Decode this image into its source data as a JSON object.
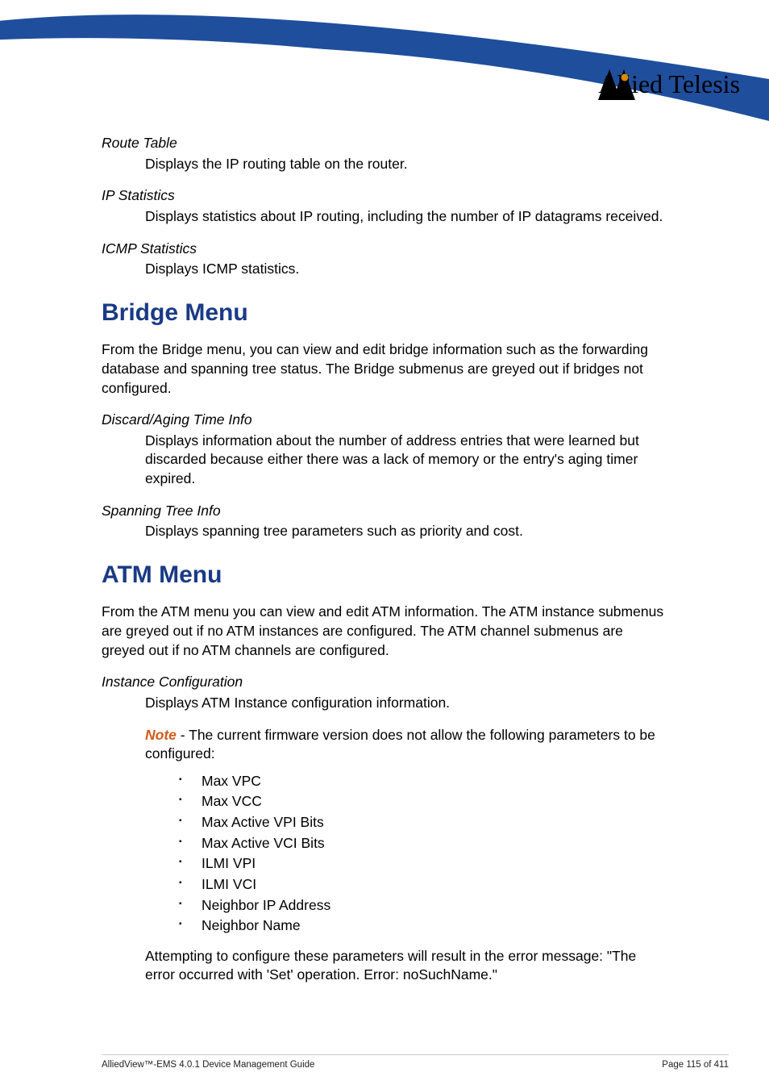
{
  "logo_text": "Allied Telesis",
  "sections": {
    "route_table": {
      "term": "Route Table",
      "desc": "Displays the IP routing table on the router."
    },
    "ip_statistics": {
      "term": "IP Statistics",
      "desc": "Displays statistics about IP routing, including the number of IP datagrams received."
    },
    "icmp_statistics": {
      "term": "ICMP Statistics",
      "desc": "Displays ICMP statistics."
    },
    "bridge_heading": "Bridge Menu",
    "bridge_intro": "From the Bridge menu, you can view and edit bridge information such as the forwarding database and spanning tree status. The Bridge submenus are greyed out if bridges not configured.",
    "discard_aging": {
      "term": "Discard/Aging Time Info",
      "desc": "Displays information about the number of address entries that were learned but discarded because either there was a lack of memory or the entry's aging timer expired."
    },
    "spanning_tree": {
      "term": "Spanning Tree Info",
      "desc": "Displays spanning tree parameters such as priority and cost."
    },
    "atm_heading": "ATM Menu",
    "atm_intro": "From the ATM menu you can view and edit ATM information. The ATM instance submenus are greyed out if no ATM instances are configured. The ATM channel submenus are greyed out if no ATM channels are configured.",
    "instance_config": {
      "term": "Instance Configuration",
      "desc": "Displays ATM Instance configuration information."
    },
    "note_word": "Note",
    "note_rest": " - The current firmware version does not allow the following parameters to be configured:",
    "params": [
      "Max VPC",
      "Max VCC",
      "Max Active VPI Bits",
      "Max Active VCI Bits",
      "ILMI VPI",
      "ILMI VCI",
      "Neighbor IP Address",
      "Neighbor Name"
    ],
    "attempt_msg": "Attempting to configure these parameters will result in the error message: \"The error occurred with 'Set' operation. Error: noSuchName.\""
  },
  "footer": {
    "left": "AlliedView™-EMS 4.0.1 Device Management Guide",
    "right": "Page 115 of 411"
  }
}
